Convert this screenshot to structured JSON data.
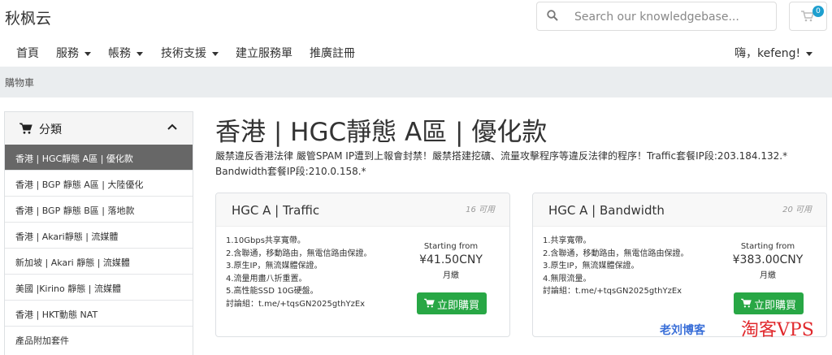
{
  "brand": {
    "logo": "秋枫云"
  },
  "search": {
    "placeholder": "Search our knowledgebase..."
  },
  "cart": {
    "count": "0"
  },
  "nav": {
    "items": [
      {
        "label": "首頁",
        "dropdown": false
      },
      {
        "label": "服務",
        "dropdown": true
      },
      {
        "label": "帳務",
        "dropdown": true
      },
      {
        "label": "技術支援",
        "dropdown": true
      },
      {
        "label": "建立服務單",
        "dropdown": false
      },
      {
        "label": "推廣註冊",
        "dropdown": false
      }
    ],
    "user": "嗨，kefeng!"
  },
  "breadcrumb": "購物車",
  "sidebar": {
    "title": "分類",
    "items": [
      {
        "label": "香港 | HGC靜態 A區 | 優化款",
        "active": true
      },
      {
        "label": "香港 | BGP 靜態 A區 | 大陸優化",
        "active": false
      },
      {
        "label": "香港 | BGP 靜態 B區 | 落地款",
        "active": false
      },
      {
        "label": "香港 | Akari靜態 | 流媒體",
        "active": false
      },
      {
        "label": "新加坡 | Akari 靜態 | 流媒體",
        "active": false
      },
      {
        "label": "美國 |Kirino 靜態 | 流媒體",
        "active": false
      },
      {
        "label": "香港 | HKT動態 NAT",
        "active": false
      },
      {
        "label": "產品附加套件",
        "active": false
      }
    ]
  },
  "main": {
    "title": "香港 | HGC靜態 A區 | 優化款",
    "notice": "嚴禁違反香港法律 嚴管SPAM IP遭到上報會封禁！嚴禁搭建挖礦、流量攻擊程序等違反法律的程序！Traffic套餐IP段:203.184.132.* Bandwidth套餐IP段:210.0.158.*"
  },
  "products": [
    {
      "name": "HGC A | Traffic",
      "qty": "16 可用",
      "features": [
        "1.10Gbps共享寬帶。",
        "2.含聯通，移動路由，無電信路由保證。",
        "3.原生IP，無流媒體保證。",
        "4.流量用盡八折重置。",
        "5.高性能SSD 10G硬盤。",
        "討論組：t.me/+tqsGN2025gthYzEx"
      ],
      "starting_from": "Starting from",
      "price": "¥41.50CNY",
      "cycle": "月繳",
      "order_label": "立即購買"
    },
    {
      "name": "HGC A | Bandwidth",
      "qty": "20 可用",
      "features": [
        "1.共享寬帶。",
        "2.含聯通，移動路由，無電信路由保證。",
        "3.原生IP，無流媒體保證。",
        "4.無限流量。",
        "討論組：t.me/+tqsGN2025gthYzEx"
      ],
      "starting_from": "Starting from",
      "price": "¥383.00CNY",
      "cycle": "月繳",
      "order_label": "立即購買"
    }
  ],
  "watermark": {
    "text_a": "老刘博客",
    "text_b": "淘客VPS"
  },
  "colors": {
    "accent": "#28a745",
    "badge": "#1e9fcf",
    "active_item": "#676767"
  }
}
